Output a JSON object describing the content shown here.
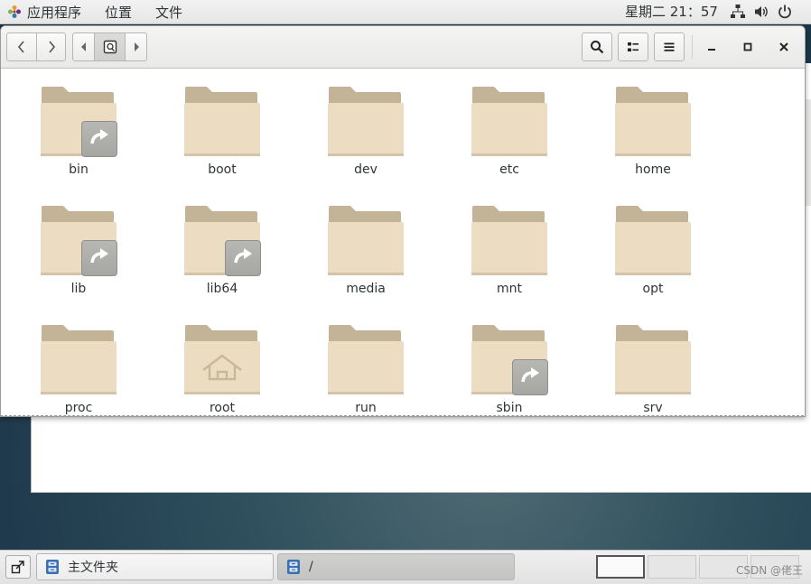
{
  "topbar": {
    "apps_label": "应用程序",
    "places_label": "位置",
    "file_label": "文件",
    "clock": "星期二 21：57"
  },
  "file_manager": {
    "path_segment": "/",
    "items": [
      {
        "name": "bin",
        "symlink": true,
        "home": false
      },
      {
        "name": "boot",
        "symlink": false,
        "home": false
      },
      {
        "name": "dev",
        "symlink": false,
        "home": false
      },
      {
        "name": "etc",
        "symlink": false,
        "home": false
      },
      {
        "name": "home",
        "symlink": false,
        "home": false
      },
      {
        "name": "lib",
        "symlink": true,
        "home": false
      },
      {
        "name": "lib64",
        "symlink": true,
        "home": false
      },
      {
        "name": "media",
        "symlink": false,
        "home": false
      },
      {
        "name": "mnt",
        "symlink": false,
        "home": false
      },
      {
        "name": "opt",
        "symlink": false,
        "home": false
      },
      {
        "name": "proc",
        "symlink": false,
        "home": false
      },
      {
        "name": "root",
        "symlink": false,
        "home": true
      },
      {
        "name": "run",
        "symlink": false,
        "home": false
      },
      {
        "name": "sbin",
        "symlink": true,
        "home": false
      },
      {
        "name": "srv",
        "symlink": false,
        "home": false
      }
    ]
  },
  "taskbar": {
    "tasks": [
      {
        "label": "主文件夹",
        "active": false
      },
      {
        "label": "/",
        "active": true
      }
    ]
  },
  "watermark": "CSDN @佬王",
  "colors": {
    "folder_back": "#c4b497",
    "folder_front": "#ecdcc2",
    "symlink_badge": "#a6a6a3"
  }
}
